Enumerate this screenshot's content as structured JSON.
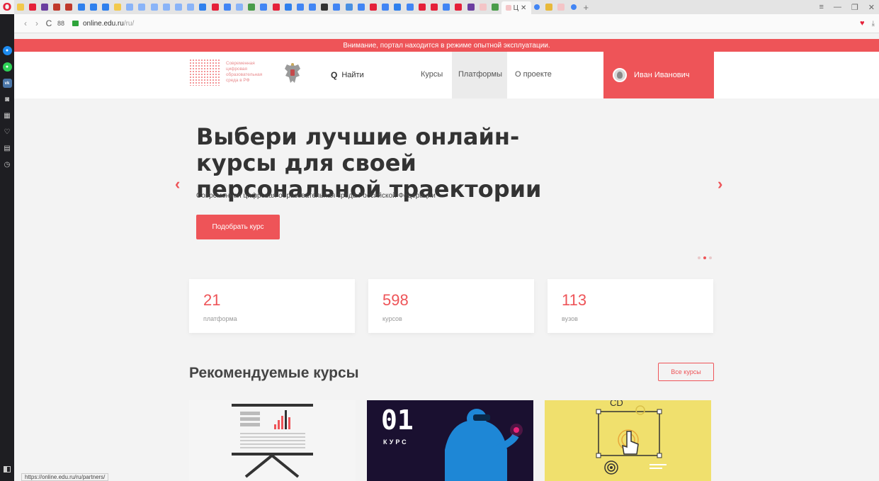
{
  "browser": {
    "url_host": "online.edu.ru",
    "url_path": "/ru/",
    "status_url": "https://online.edu.ru/ru/partners/",
    "active_tab_label": "Ц",
    "win_controls": [
      "≡",
      "—",
      "❐",
      "✕"
    ],
    "accent": "#e5213a"
  },
  "site": {
    "alert": "Внимание, портал находится в режиме опытной эксплуатации.",
    "logo_text": "Современная цифровая образовательная среда в РФ",
    "nav": {
      "search": "Найти",
      "courses": "Курсы",
      "platforms": "Платформы",
      "about": "О проекте"
    },
    "user_name": "Иван Иванович",
    "hero": {
      "title": "Выбери лучшие онлайн-курсы для своей персональной траектории",
      "subtitle": "Современная цифровая образовательная среда Российской Федерации",
      "button": "Подобрать курс"
    },
    "stats": [
      {
        "value": "21",
        "label": "платформа"
      },
      {
        "value": "598",
        "label": "курсов"
      },
      {
        "value": "113",
        "label": "вузов"
      }
    ],
    "recommended": {
      "title": "Рекомендуемые курсы",
      "all_button": "Все курсы",
      "card2_number": "01",
      "card2_word": "КУРС",
      "card3_text": "CD"
    },
    "accent": "#ee5458"
  }
}
